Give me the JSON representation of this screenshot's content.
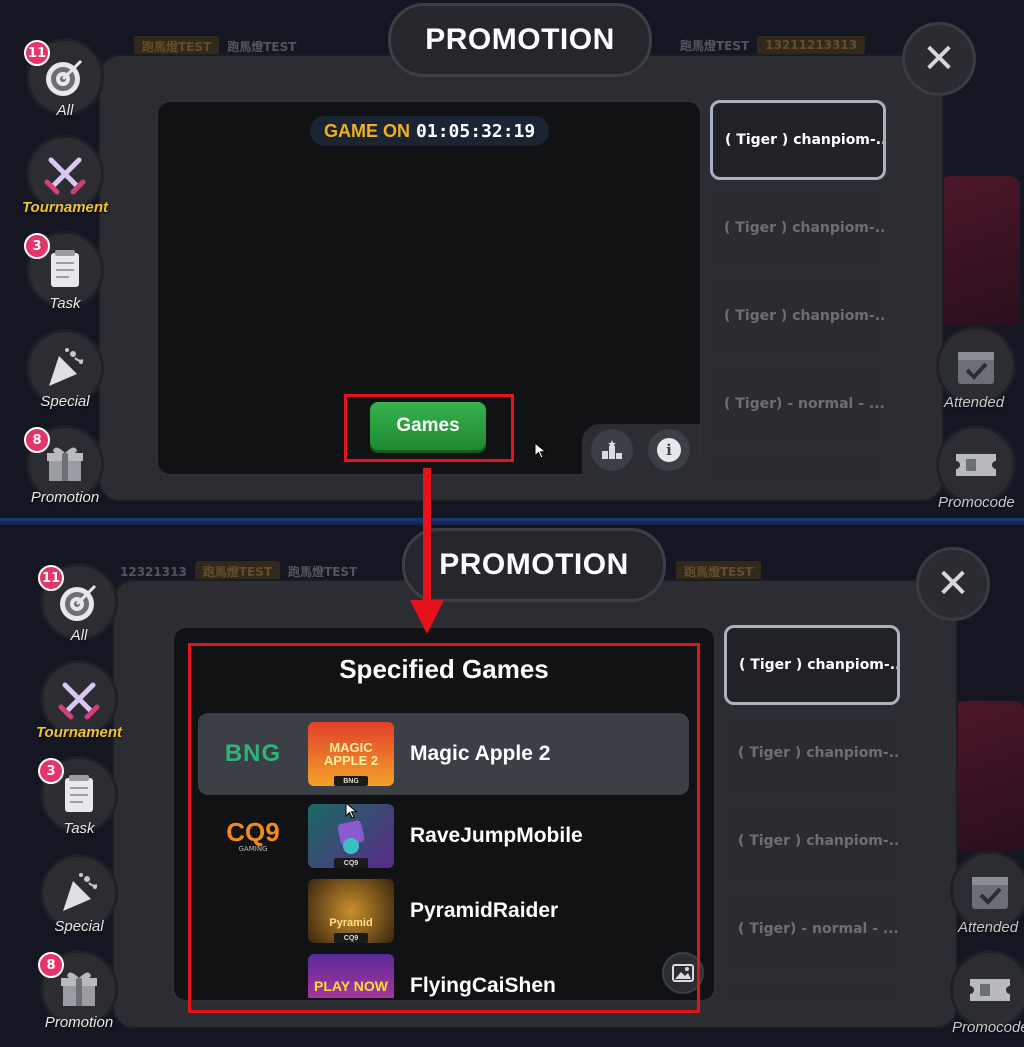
{
  "modal_title": "PROMOTION",
  "close_label": "✕",
  "side_nav": [
    {
      "label": "All",
      "badge": "11",
      "icon": "target-icon"
    },
    {
      "label": "Tournament",
      "badge": "",
      "icon": "crossed-swords-icon"
    },
    {
      "label": "Task",
      "badge": "3",
      "icon": "notepad-icon"
    },
    {
      "label": "Special",
      "badge": "",
      "icon": "party-popper-icon"
    },
    {
      "label": "Promotion",
      "badge": "8",
      "icon": "gift-icon"
    }
  ],
  "right_actions": [
    {
      "label": "Attended",
      "icon": "calendar-check-icon"
    },
    {
      "label": "Promocode",
      "icon": "ticket-icon"
    }
  ],
  "promotions": [
    "( Tiger ) chanpiom-...",
    "( Tiger ) chanpiom-...",
    "( Tiger ) chanpiom-...",
    "( Tiger) - normal - ..."
  ],
  "timer": {
    "status": "GAME ON",
    "countdown": "01:05:32:19"
  },
  "games_button": "Games",
  "specified_games": {
    "title": "Specified Games",
    "items": [
      {
        "provider": "BNG",
        "name": "Magic Apple 2",
        "thumb_text": "MAGIC APPLE 2",
        "thumb_tag": "BNG"
      },
      {
        "provider": "CQ9",
        "provider_sub": "GAMING",
        "name": "RaveJumpMobile",
        "thumb_text": "",
        "thumb_tag": "CQ9"
      },
      {
        "provider": "",
        "name": "PyramidRaider",
        "thumb_text": "Pyramid",
        "thumb_tag": "CQ9"
      },
      {
        "provider": "",
        "name": "FlyingCaiShen",
        "thumb_text": "PLAY NOW",
        "thumb_tag": ""
      }
    ]
  },
  "ticker_top": [
    "跑馬燈TEST",
    "跑馬燈TEST",
    "跑馬燈TEST",
    "13211213313"
  ],
  "ticker_bottom": [
    "12321313",
    "跑馬燈TEST",
    "跑馬燈TEST",
    "跑馬燈TEST"
  ],
  "colors": {
    "highlight_red": "#e5121b",
    "accent_gold": "#f0b020",
    "button_green": "#2ea043",
    "badge_pink": "#e4346a"
  }
}
